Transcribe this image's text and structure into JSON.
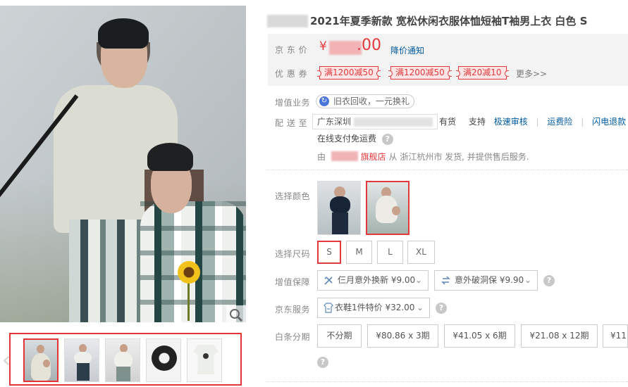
{
  "gallery": {
    "zoom_icon": "magnifier-icon",
    "thumbnails": [
      {
        "id": "couple-front",
        "selected": true
      },
      {
        "id": "man-dark-pants",
        "selected": false
      },
      {
        "id": "man-side-view",
        "selected": false
      },
      {
        "id": "circle-print-detail",
        "selected": false
      },
      {
        "id": "white-tee-flat",
        "selected": false
      }
    ],
    "left_arrow": "‹",
    "right_arrow": "›"
  },
  "product": {
    "title": "2021年夏季新款 宽松休闲衣服体恤短袖T袖男上衣 白色 S",
    "price_label": "京 东 价",
    "price_symbol": "¥",
    "price_suffix": ".00",
    "price_notice": "降价通知",
    "coupon_label": "优 惠 券",
    "coupons": [
      "满1200减50",
      "满1200减50",
      "满20减10"
    ],
    "more": "更多>>"
  },
  "service": {
    "value_added_label": "增值业务",
    "recycle_text": "旧衣回收，一元换礼",
    "delivery_label": "配 送 至",
    "address_prefix": "广东深圳",
    "stock_text": "有货",
    "support_text": "支持",
    "support_links": [
      "极速审核",
      "运费险",
      "闪电退款"
    ],
    "online_pay_text": "在线支付免运费",
    "seller_prefix": "由",
    "seller_suffix": "旗舰店",
    "shipping_text": "从 浙江杭州市 发货, 并提供售后服务."
  },
  "options": {
    "color_label": "选择颜色",
    "color_choices": [
      {
        "name": "dark-shirt",
        "selected": false
      },
      {
        "name": "white-shirt",
        "selected": true
      }
    ],
    "size_label": "选择尺码",
    "sizes": [
      "S",
      "M",
      "L",
      "XL"
    ],
    "selected_size": "S",
    "protection_label": "增值保障",
    "protection_options": [
      "仨月意外换新 ¥9.00",
      "意外破洞保 ¥9.90"
    ],
    "jd_service_label": "京东服务",
    "jd_service_option": "衣鞋1件特价 ¥32.00",
    "installment_label": "白条分期",
    "installments": [
      "不分期",
      "¥80.86 x 3期",
      "¥41.05 x 6期",
      "¥21.08 x 12期",
      "¥11"
    ]
  },
  "icons": {
    "recycle": "recycle-icon",
    "question": "question-icon",
    "wrench": "repair-icon",
    "swap": "exchange-icon",
    "shirt_service": "clothing-service-icon",
    "chevron": "chevron-down-icon"
  },
  "colors": {
    "accent_red": "#e43435",
    "price_red": "#e4393c",
    "link_blue": "#005aa0"
  }
}
